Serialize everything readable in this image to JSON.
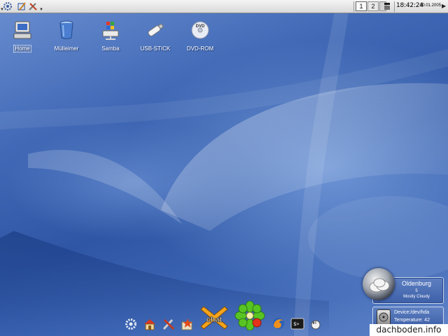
{
  "top_panel": {
    "launchers": [
      {
        "name": "kde-menu-icon"
      },
      {
        "name": "edit-icon"
      },
      {
        "name": "tools-icon"
      }
    ],
    "pager": [
      "1",
      "2"
    ],
    "clock": {
      "time": "18:42:24",
      "date": "30.01.2005"
    }
  },
  "desktop_icons": [
    {
      "label": "Home",
      "icon": "computer-icon"
    },
    {
      "label": "Mülleimer",
      "icon": "trash-icon"
    },
    {
      "label": "Samba",
      "icon": "samba-icon"
    },
    {
      "label": "USB-STICK",
      "icon": "usb-stick-icon"
    },
    {
      "label": "DVD-ROM",
      "icon": "dvd-icon"
    }
  ],
  "dock": {
    "items": [
      {
        "icon": "kde-gear-icon"
      },
      {
        "icon": "home-icon"
      },
      {
        "icon": "tools-icon"
      },
      {
        "icon": "star-icon"
      },
      {
        "icon": "chat-icon",
        "text": "chat"
      },
      {
        "icon": "icq-flower-icon"
      },
      {
        "icon": "firefox-icon"
      },
      {
        "icon": "terminal-icon",
        "text": "$>"
      },
      {
        "icon": "mouse-icon"
      }
    ]
  },
  "weather": {
    "city": "Oldenburg",
    "temperature": "5",
    "condition": "Mostly Cloudy"
  },
  "hdd": {
    "device": "Device:/dev/hda",
    "temperature": "Temperature: 42"
  },
  "watermark": "dachboden.info",
  "colors": {
    "wallpaper_blue": "#3a5fae",
    "panel_gray": "#e6e6e6",
    "icq_green": "#55c21f",
    "chat_orange": "#f1a11c"
  }
}
